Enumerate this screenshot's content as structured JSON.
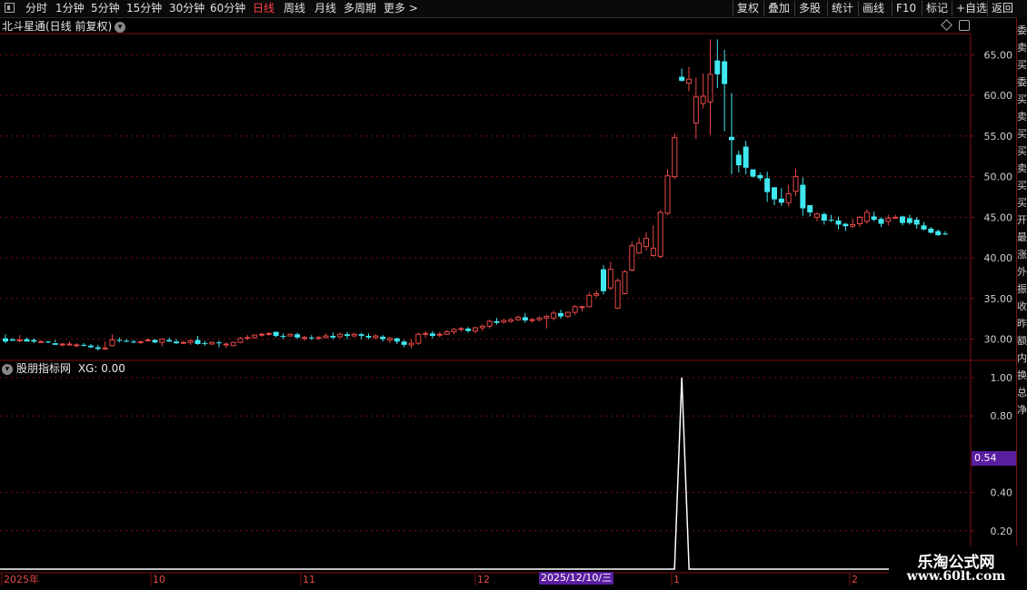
{
  "toolbar": {
    "periods": [
      "分时",
      "1分钟",
      "5分钟",
      "15分钟",
      "30分钟",
      "60分钟",
      "日线",
      "周线",
      "月线",
      "多周期",
      "更多 >"
    ],
    "active_period": "日线",
    "right_buttons": [
      "复权",
      "叠加",
      "多股",
      "统计",
      "画线",
      "F10",
      "标记",
      "+自选",
      "返回"
    ]
  },
  "main_chart": {
    "title": "北斗星通(日线 前复权)",
    "y_ticks": [
      "65.00",
      "60.00",
      "55.00",
      "50.00",
      "45.00",
      "40.00",
      "35.00",
      "30.00"
    ]
  },
  "indicator": {
    "title": "股朋指标网",
    "series_label": "XG: 0.00",
    "y_ticks": [
      "1.00",
      "0.80",
      "0.54",
      "0.40",
      "0.20"
    ],
    "current_value_tag": "0.54"
  },
  "x_axis": {
    "labels": [
      "2025年",
      "10",
      "11",
      "12",
      "1",
      "2"
    ],
    "cursor_date": "2025/12/10/三"
  },
  "side_strip_chars": [
    "委",
    "卖",
    "买",
    "委",
    "买",
    "卖",
    "买",
    "买",
    "卖",
    "买",
    "买",
    "开",
    "最",
    "涨",
    "外",
    "振",
    "收",
    "昨",
    "额",
    "内",
    "换",
    "总",
    "净"
  ],
  "watermark": {
    "title": "乐淘公式网",
    "url": "www.60lt.com"
  },
  "colors": {
    "up": "#e84848",
    "down": "#40e8f0",
    "grid": "#7a1010",
    "line": "#ffffff",
    "tag_bg": "#5a1ea0"
  },
  "chart_data": [
    {
      "type": "candlestick",
      "title": "北斗星通(日线 前复权)",
      "ylim": [
        27.5,
        67.5
      ],
      "x_labels": [
        "2025年",
        "10",
        "11",
        "12",
        "1",
        "2"
      ],
      "candles": [
        [
          30.1,
          30.6,
          29.7,
          29.5
        ],
        [
          30.0,
          30.2,
          29.8,
          30.1
        ],
        [
          29.8,
          30.5,
          29.9,
          29.6
        ],
        [
          30.0,
          30.2,
          29.7,
          29.9
        ],
        [
          29.9,
          30.1,
          29.7,
          29.5
        ],
        [
          29.6,
          29.9,
          29.7,
          29.6
        ],
        [
          29.7,
          29.8,
          29.6,
          29.5
        ],
        [
          29.5,
          29.9,
          29.3,
          29.6
        ],
        [
          29.4,
          29.5,
          29.4,
          29.1
        ],
        [
          29.3,
          29.7,
          29.4,
          29.2
        ],
        [
          29.2,
          29.5,
          29.3,
          29.0
        ],
        [
          29.3,
          29.5,
          29.2,
          29.1
        ],
        [
          29.2,
          29.4,
          29.0,
          28.9
        ],
        [
          29.0,
          29.3,
          28.8,
          28.6
        ],
        [
          28.9,
          29.7,
          28.9,
          28.7
        ],
        [
          29.2,
          30.6,
          29.9,
          29.1
        ],
        [
          29.9,
          30.2,
          29.8,
          29.6
        ],
        [
          29.8,
          30.0,
          29.7,
          29.6
        ],
        [
          29.7,
          29.9,
          29.6,
          29.5
        ],
        [
          29.6,
          29.8,
          29.7,
          29.4
        ],
        [
          29.8,
          30.1,
          29.9,
          29.7
        ],
        [
          29.9,
          30.0,
          29.6,
          29.5
        ],
        [
          29.6,
          30.1,
          30.0,
          29.1
        ],
        [
          29.9,
          30.2,
          29.7,
          29.7
        ],
        [
          29.7,
          30.0,
          29.5,
          29.4
        ],
        [
          29.5,
          29.8,
          29.6,
          29.4
        ],
        [
          29.6,
          30.0,
          29.8,
          29.3
        ],
        [
          29.9,
          30.4,
          29.4,
          29.3
        ],
        [
          29.5,
          29.8,
          29.4,
          29.2
        ],
        [
          29.4,
          29.7,
          29.6,
          29.3
        ],
        [
          29.6,
          29.8,
          29.5,
          29.0
        ],
        [
          29.3,
          29.6,
          29.4,
          28.9
        ],
        [
          29.2,
          29.7,
          29.6,
          29.1
        ],
        [
          29.6,
          30.3,
          30.1,
          29.5
        ],
        [
          30.1,
          30.5,
          30.2,
          29.9
        ],
        [
          30.2,
          30.6,
          30.5,
          30.0
        ],
        [
          30.5,
          30.8,
          30.6,
          30.3
        ],
        [
          30.6,
          30.9,
          30.7,
          30.4
        ],
        [
          30.9,
          30.9,
          30.4,
          30.2
        ],
        [
          30.4,
          30.7,
          30.3,
          30.0
        ],
        [
          30.4,
          30.7,
          30.6,
          30.3
        ],
        [
          30.6,
          30.8,
          30.2,
          30.0
        ],
        [
          30.1,
          30.4,
          30.2,
          29.8
        ],
        [
          30.2,
          30.5,
          30.1,
          29.9
        ],
        [
          30.1,
          30.4,
          30.2,
          29.9
        ],
        [
          30.2,
          30.7,
          30.4,
          30.1
        ],
        [
          30.4,
          30.8,
          30.2,
          30.0
        ],
        [
          30.3,
          30.8,
          30.6,
          30.1
        ],
        [
          30.6,
          30.9,
          30.4,
          30.0
        ],
        [
          30.4,
          30.8,
          30.6,
          30.2
        ],
        [
          30.6,
          30.8,
          30.4,
          30.0
        ],
        [
          30.4,
          30.7,
          30.2,
          30.0
        ],
        [
          30.2,
          30.6,
          30.4,
          30.0
        ],
        [
          30.3,
          30.5,
          30.0,
          29.7
        ],
        [
          29.9,
          30.3,
          30.1,
          29.5
        ],
        [
          30.1,
          30.2,
          29.7,
          29.4
        ],
        [
          29.7,
          29.9,
          29.3,
          29.0
        ],
        [
          29.3,
          30.0,
          29.5,
          28.9
        ],
        [
          29.5,
          30.8,
          30.6,
          29.3
        ],
        [
          30.6,
          31.0,
          30.7,
          30.2
        ],
        [
          30.7,
          31.0,
          30.4,
          30.1
        ],
        [
          30.5,
          30.9,
          30.6,
          30.2
        ],
        [
          30.6,
          31.1,
          30.9,
          30.5
        ],
        [
          30.9,
          31.4,
          31.2,
          30.6
        ],
        [
          31.2,
          31.5,
          31.3,
          30.9
        ],
        [
          31.3,
          31.5,
          31.0,
          30.8
        ],
        [
          31.0,
          31.5,
          31.4,
          30.7
        ],
        [
          31.4,
          31.8,
          31.6,
          31.0
        ],
        [
          31.6,
          32.4,
          32.2,
          31.3
        ],
        [
          32.2,
          32.6,
          32.0,
          31.8
        ],
        [
          32.1,
          32.5,
          32.3,
          31.9
        ],
        [
          32.2,
          32.6,
          32.4,
          32.0
        ],
        [
          32.4,
          32.9,
          32.7,
          32.2
        ],
        [
          32.7,
          33.2,
          32.3,
          32.0
        ],
        [
          32.3,
          32.6,
          32.4,
          32.0
        ],
        [
          32.4,
          32.8,
          32.6,
          32.2
        ],
        [
          32.6,
          33.0,
          32.8,
          31.3
        ],
        [
          32.6,
          33.5,
          33.2,
          32.3
        ],
        [
          33.2,
          33.6,
          32.8,
          32.5
        ],
        [
          32.8,
          33.4,
          33.3,
          32.6
        ],
        [
          33.3,
          34.2,
          34.0,
          33.0
        ],
        [
          33.9,
          34.1,
          34.0,
          33.4
        ],
        [
          34.0,
          35.8,
          35.4,
          33.9
        ],
        [
          35.4,
          36.0,
          35.6,
          35.1
        ],
        [
          38.6,
          39.1,
          35.9,
          35.5
        ],
        [
          36.3,
          39.5,
          38.6,
          36.0
        ],
        [
          33.8,
          37.5,
          37.2,
          33.7
        ],
        [
          35.6,
          38.5,
          38.3,
          35.5
        ],
        [
          38.5,
          42.0,
          41.5,
          38.3
        ],
        [
          40.6,
          42.5,
          41.8,
          40.5
        ],
        [
          41.4,
          43.2,
          42.4,
          40.9
        ],
        [
          40.3,
          44.0,
          41.2,
          40.1
        ],
        [
          40.2,
          45.9,
          45.6,
          40.0
        ],
        [
          45.5,
          50.9,
          50.1,
          45.3
        ],
        [
          50.0,
          55.3,
          54.8,
          49.7
        ],
        [
          62.3,
          63.3,
          61.8,
          61.7
        ],
        [
          61.5,
          63.5,
          62.0,
          60.5
        ],
        [
          56.6,
          62.2,
          59.8,
          54.6
        ],
        [
          59.0,
          62.7,
          59.9,
          58.4
        ],
        [
          59.2,
          66.9,
          62.6,
          55.2
        ],
        [
          64.3,
          66.9,
          62.6,
          60.9
        ],
        [
          64.2,
          65.6,
          61.4,
          55.6
        ],
        [
          54.9,
          60.3,
          54.5,
          50.3
        ],
        [
          52.7,
          53.2,
          51.4,
          50.5
        ],
        [
          53.7,
          54.4,
          51.1,
          50.3
        ],
        [
          50.9,
          50.7,
          50.0,
          49.9
        ],
        [
          50.2,
          50.5,
          49.8,
          49.5
        ],
        [
          49.8,
          50.6,
          48.1,
          46.9
        ],
        [
          48.7,
          48.0,
          47.2,
          46.5
        ],
        [
          47.3,
          48.6,
          46.8,
          46.4
        ],
        [
          46.8,
          49.0,
          47.9,
          46.3
        ],
        [
          48.2,
          51.0,
          50.0,
          47.6
        ],
        [
          49.0,
          49.9,
          46.1,
          45.2
        ],
        [
          46.5,
          46.5,
          45.6,
          45.1
        ],
        [
          45.0,
          45.6,
          45.4,
          44.5
        ],
        [
          45.4,
          45.6,
          44.6,
          44.1
        ],
        [
          44.7,
          45.3,
          44.6,
          44.4
        ],
        [
          44.6,
          45.1,
          44.1,
          43.5
        ],
        [
          44.2,
          44.3,
          43.9,
          43.3
        ],
        [
          43.9,
          44.8,
          44.1,
          43.7
        ],
        [
          44.2,
          45.2,
          45.0,
          43.8
        ],
        [
          44.5,
          46.0,
          45.6,
          44.2
        ],
        [
          45.1,
          45.7,
          44.7,
          44.5
        ],
        [
          44.8,
          45.0,
          44.2,
          43.8
        ],
        [
          44.5,
          45.3,
          44.9,
          44.0
        ],
        [
          44.9,
          45.3,
          45.0,
          44.8
        ],
        [
          45.1,
          45.2,
          44.3,
          44.0
        ],
        [
          44.9,
          45.3,
          44.3,
          44.1
        ],
        [
          44.7,
          45.0,
          44.1,
          43.6
        ],
        [
          44.0,
          44.4,
          43.5,
          43.4
        ],
        [
          43.6,
          43.8,
          43.1,
          43.0
        ],
        [
          43.3,
          43.5,
          42.8,
          42.7
        ],
        [
          43.0,
          43.3,
          42.9,
          42.8
        ]
      ],
      "candle_fields": [
        "open",
        "high",
        "close",
        "low"
      ]
    },
    {
      "type": "line",
      "title": "股朋指标网",
      "series": [
        {
          "name": "XG",
          "peak_index": 95,
          "peak_value": 1.0,
          "base_value": 0.0
        }
      ],
      "ylim": [
        0.0,
        1.06
      ]
    }
  ]
}
